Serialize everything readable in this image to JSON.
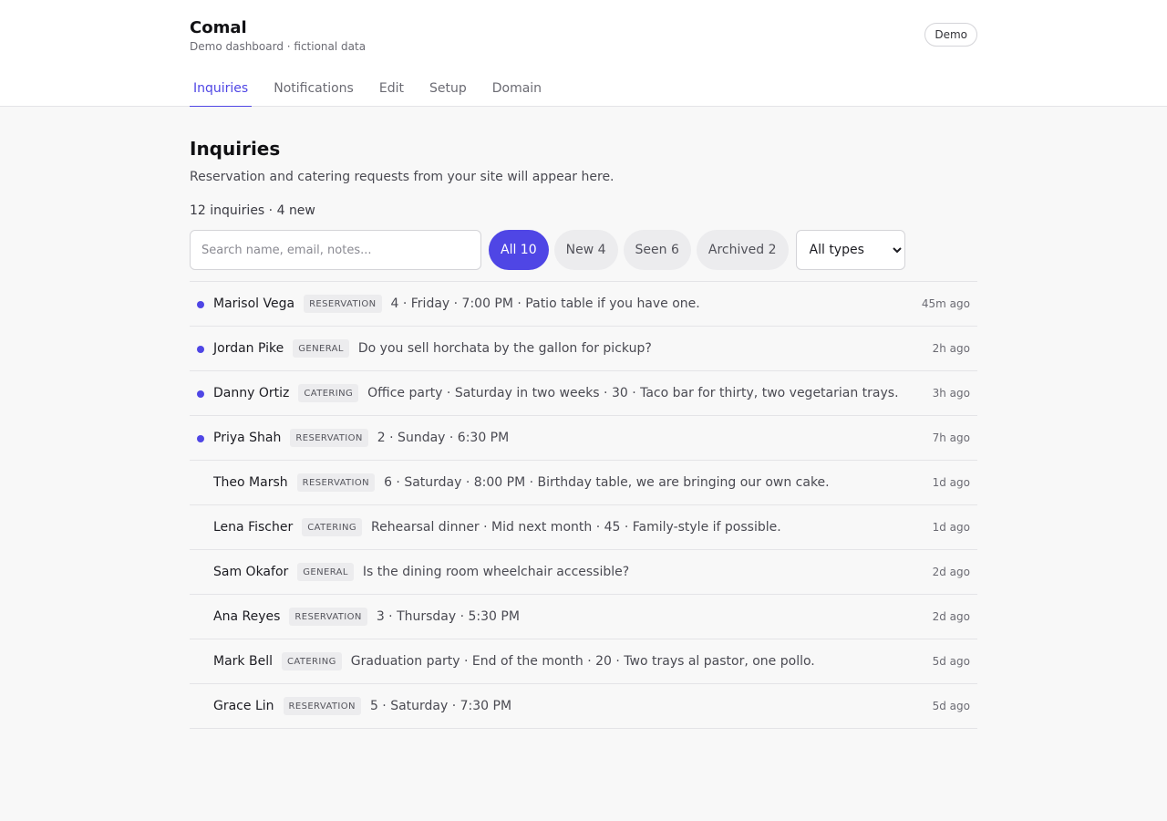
{
  "app": {
    "title": "Comal",
    "subtitle": "Demo dashboard · fictional data",
    "badge": "Demo"
  },
  "tabs": [
    {
      "label": "Inquiries",
      "active": true
    },
    {
      "label": "Notifications",
      "active": false
    },
    {
      "label": "Edit",
      "active": false
    },
    {
      "label": "Setup",
      "active": false
    },
    {
      "label": "Domain",
      "active": false
    }
  ],
  "page": {
    "title": "Inquiries",
    "description": "Reservation and catering requests from your site will appear here.",
    "count_line": "12 inquiries · 4 new"
  },
  "filters": {
    "search_placeholder": "Search name, email, notes...",
    "pills": [
      {
        "label": "All 10",
        "active": true
      },
      {
        "label": "New 4",
        "active": false
      },
      {
        "label": "Seen 6",
        "active": false
      },
      {
        "label": "Archived 2",
        "active": false
      }
    ],
    "type_select": {
      "selected": "All types"
    }
  },
  "inquiries": [
    {
      "name": "Marisol Vega",
      "type": "RESERVATION",
      "summary": "4 · Friday · 7:00 PM · Patio table if you have one.",
      "time": "45m ago",
      "unread": true
    },
    {
      "name": "Jordan Pike",
      "type": "GENERAL",
      "summary": "Do you sell horchata by the gallon for pickup?",
      "time": "2h ago",
      "unread": true
    },
    {
      "name": "Danny Ortiz",
      "type": "CATERING",
      "summary": "Office party · Saturday in two weeks · 30 · Taco bar for thirty, two vegetarian trays.",
      "time": "3h ago",
      "unread": true
    },
    {
      "name": "Priya Shah",
      "type": "RESERVATION",
      "summary": "2 · Sunday · 6:30 PM",
      "time": "7h ago",
      "unread": true
    },
    {
      "name": "Theo Marsh",
      "type": "RESERVATION",
      "summary": "6 · Saturday · 8:00 PM · Birthday table, we are bringing our own cake.",
      "time": "1d ago",
      "unread": false
    },
    {
      "name": "Lena Fischer",
      "type": "CATERING",
      "summary": "Rehearsal dinner · Mid next month · 45 · Family-style if possible.",
      "time": "1d ago",
      "unread": false
    },
    {
      "name": "Sam Okafor",
      "type": "GENERAL",
      "summary": "Is the dining room wheelchair accessible?",
      "time": "2d ago",
      "unread": false
    },
    {
      "name": "Ana Reyes",
      "type": "RESERVATION",
      "summary": "3 · Thursday · 5:30 PM",
      "time": "2d ago",
      "unread": false
    },
    {
      "name": "Mark Bell",
      "type": "CATERING",
      "summary": "Graduation party · End of the month · 20 · Two trays al pastor, one pollo.",
      "time": "5d ago",
      "unread": false
    },
    {
      "name": "Grace Lin",
      "type": "RESERVATION",
      "summary": "5 · Saturday · 7:30 PM",
      "time": "5d ago",
      "unread": false
    }
  ],
  "colors": {
    "accent": "#4f46e5",
    "background": "#f8f8f8",
    "border": "#e4e4e7"
  }
}
